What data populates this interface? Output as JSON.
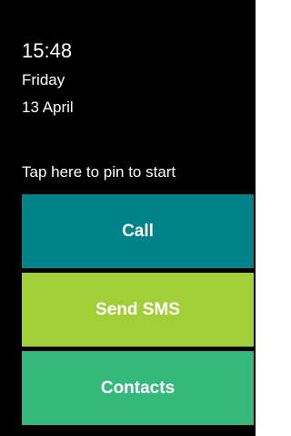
{
  "status": {
    "time": "15:48",
    "day": "Friday",
    "date": "13 April"
  },
  "pin_hint": "Tap here to pin to start",
  "tiles": [
    {
      "label": "Call",
      "color": "#008289"
    },
    {
      "label": "Send SMS",
      "color": "#a2cf38"
    },
    {
      "label": "Contacts",
      "color": "#35b87b"
    }
  ]
}
